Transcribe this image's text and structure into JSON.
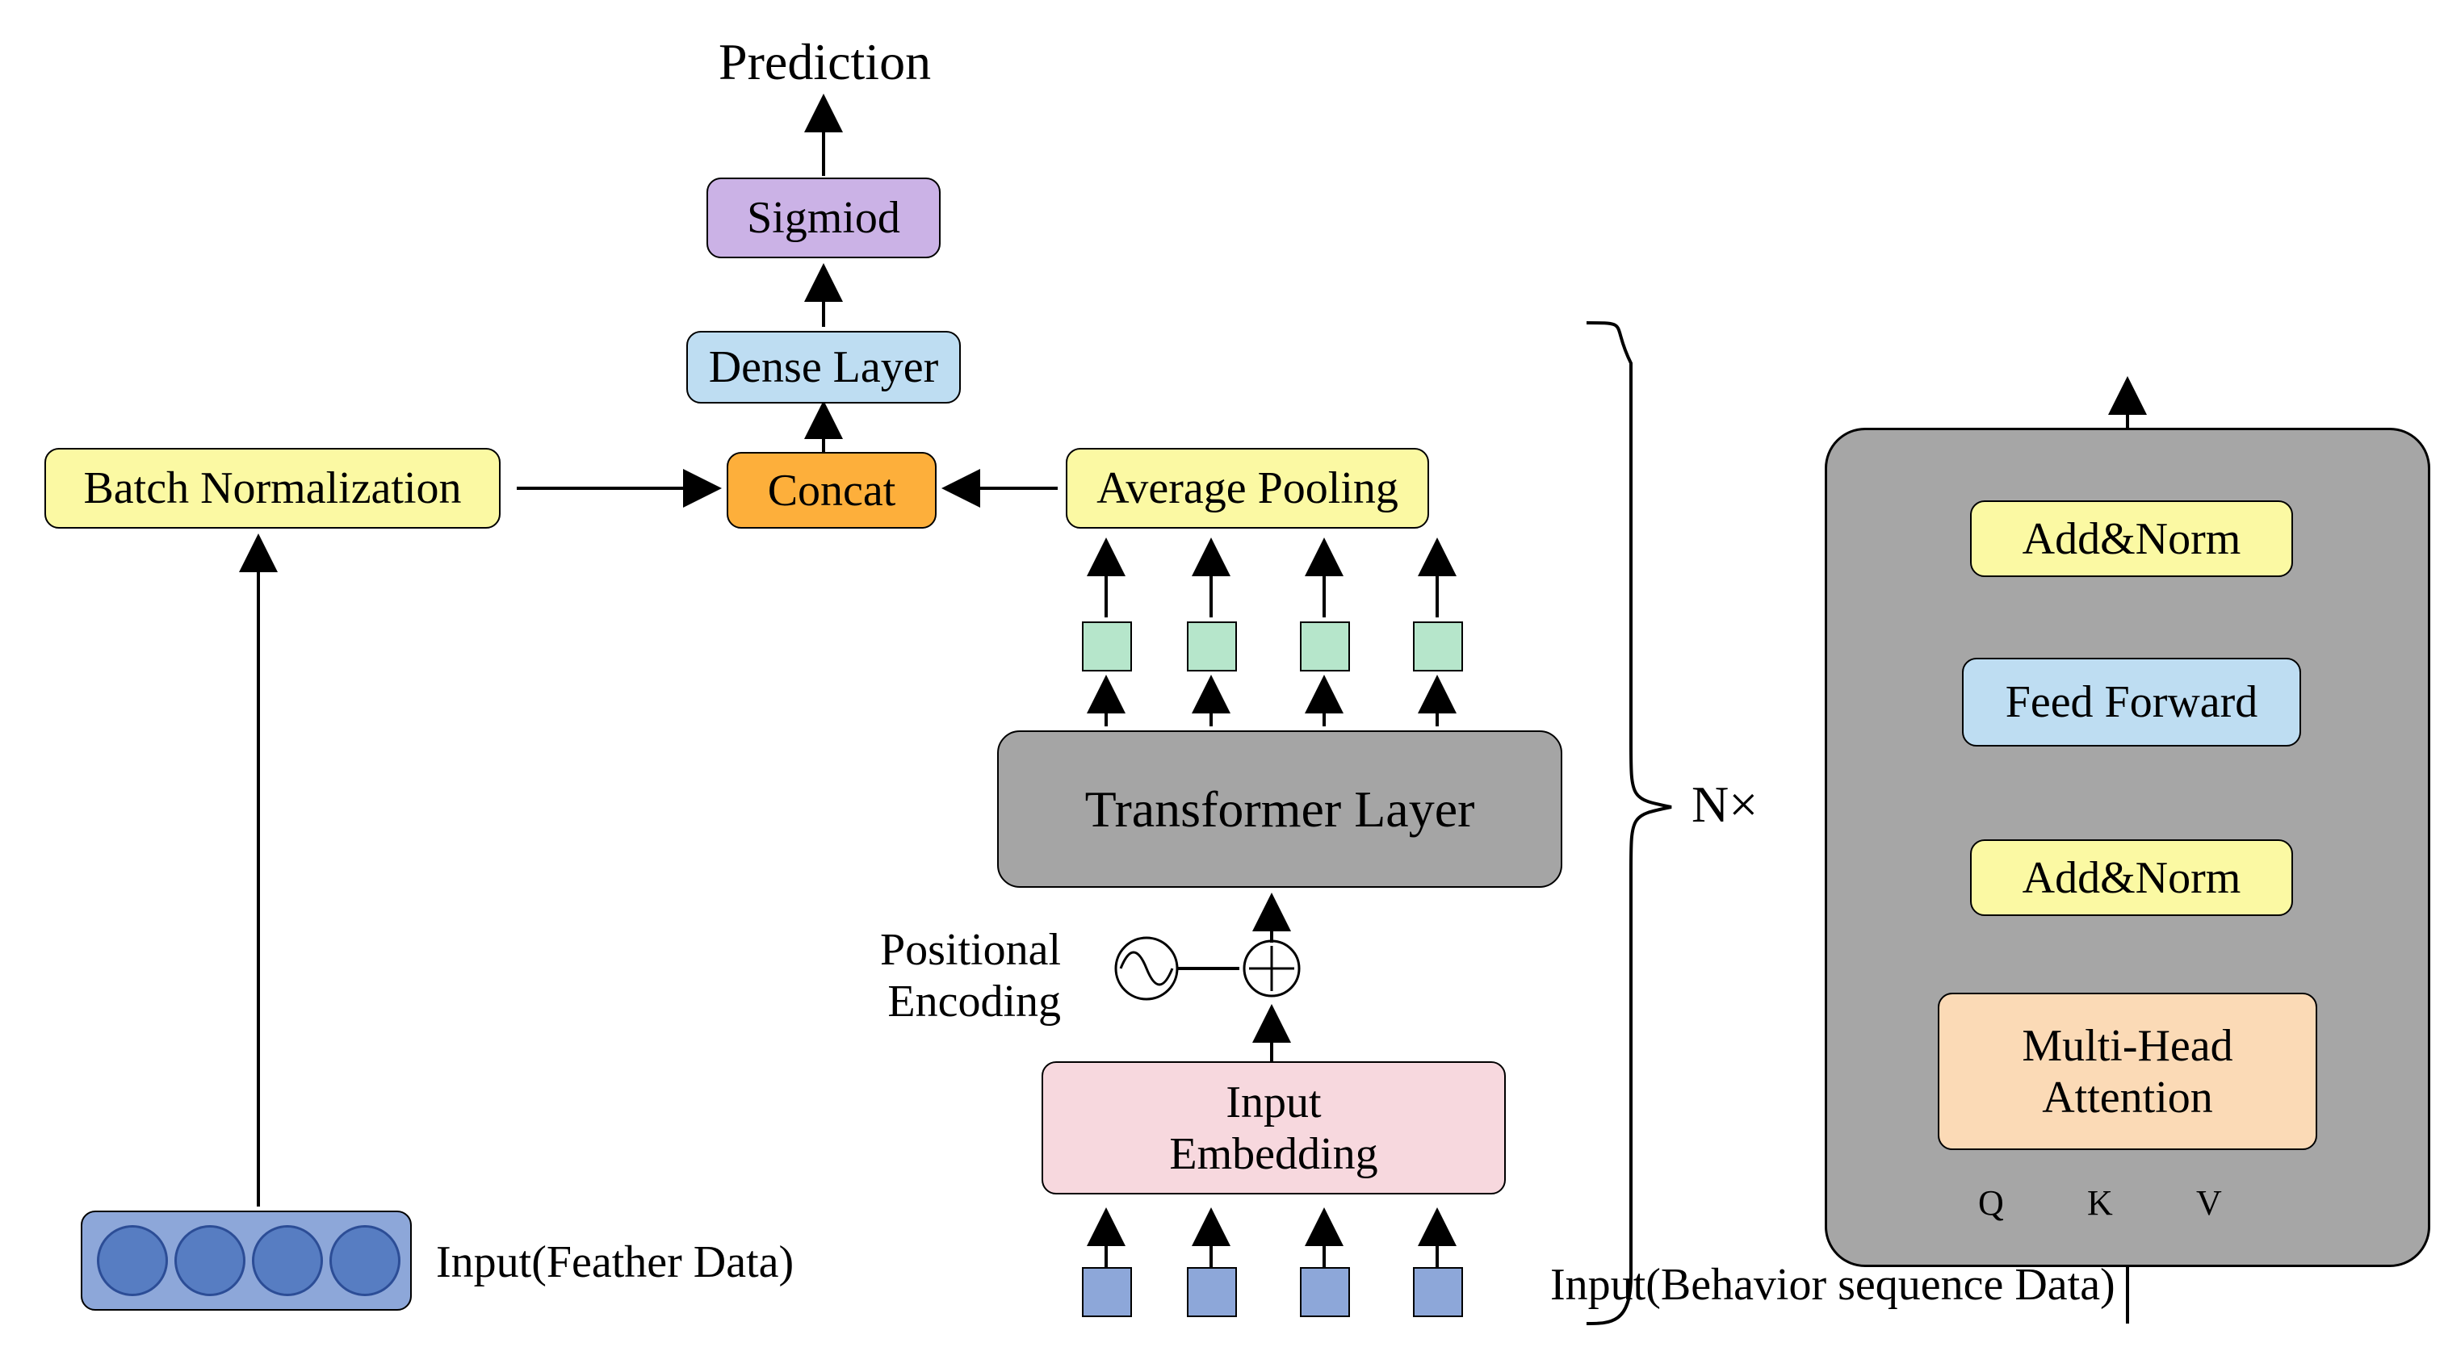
{
  "labels": {
    "prediction": "Prediction",
    "sigmoid": "Sigmiod",
    "dense": "Dense Layer",
    "concat": "Concat",
    "batchnorm": "Batch Normalization",
    "avgpool": "Average Pooling",
    "transformer": "Transformer Layer",
    "positional": "Positional\nEncoding",
    "inputembed": "Input\nEmbedding",
    "input_feather": "Input(Feather Data)",
    "input_behavior": "Input(Behavior sequence Data)",
    "Ntimes": "N×",
    "addnorm": "Add&Norm",
    "feedforward": "Feed Forward",
    "multihead": "Multi-Head\nAttention",
    "Q": "Q",
    "K": "K",
    "V": "V"
  },
  "colors": {
    "yellow": "#FBF9A3",
    "purple": "#CBB2E6",
    "blue": "#BEDDF2",
    "orange": "#FDAF3B",
    "green": "#B6E6CB",
    "grey": "#A5A5A5",
    "pink": "#F7D8DE",
    "peach": "#FBDAB6",
    "slateblue": "#8DA7D9",
    "circleblue": "#577DC2",
    "greybox": "#A6A6A6"
  },
  "feather_circles": 4,
  "behavior_inputs": 4,
  "green_outputs": 4
}
